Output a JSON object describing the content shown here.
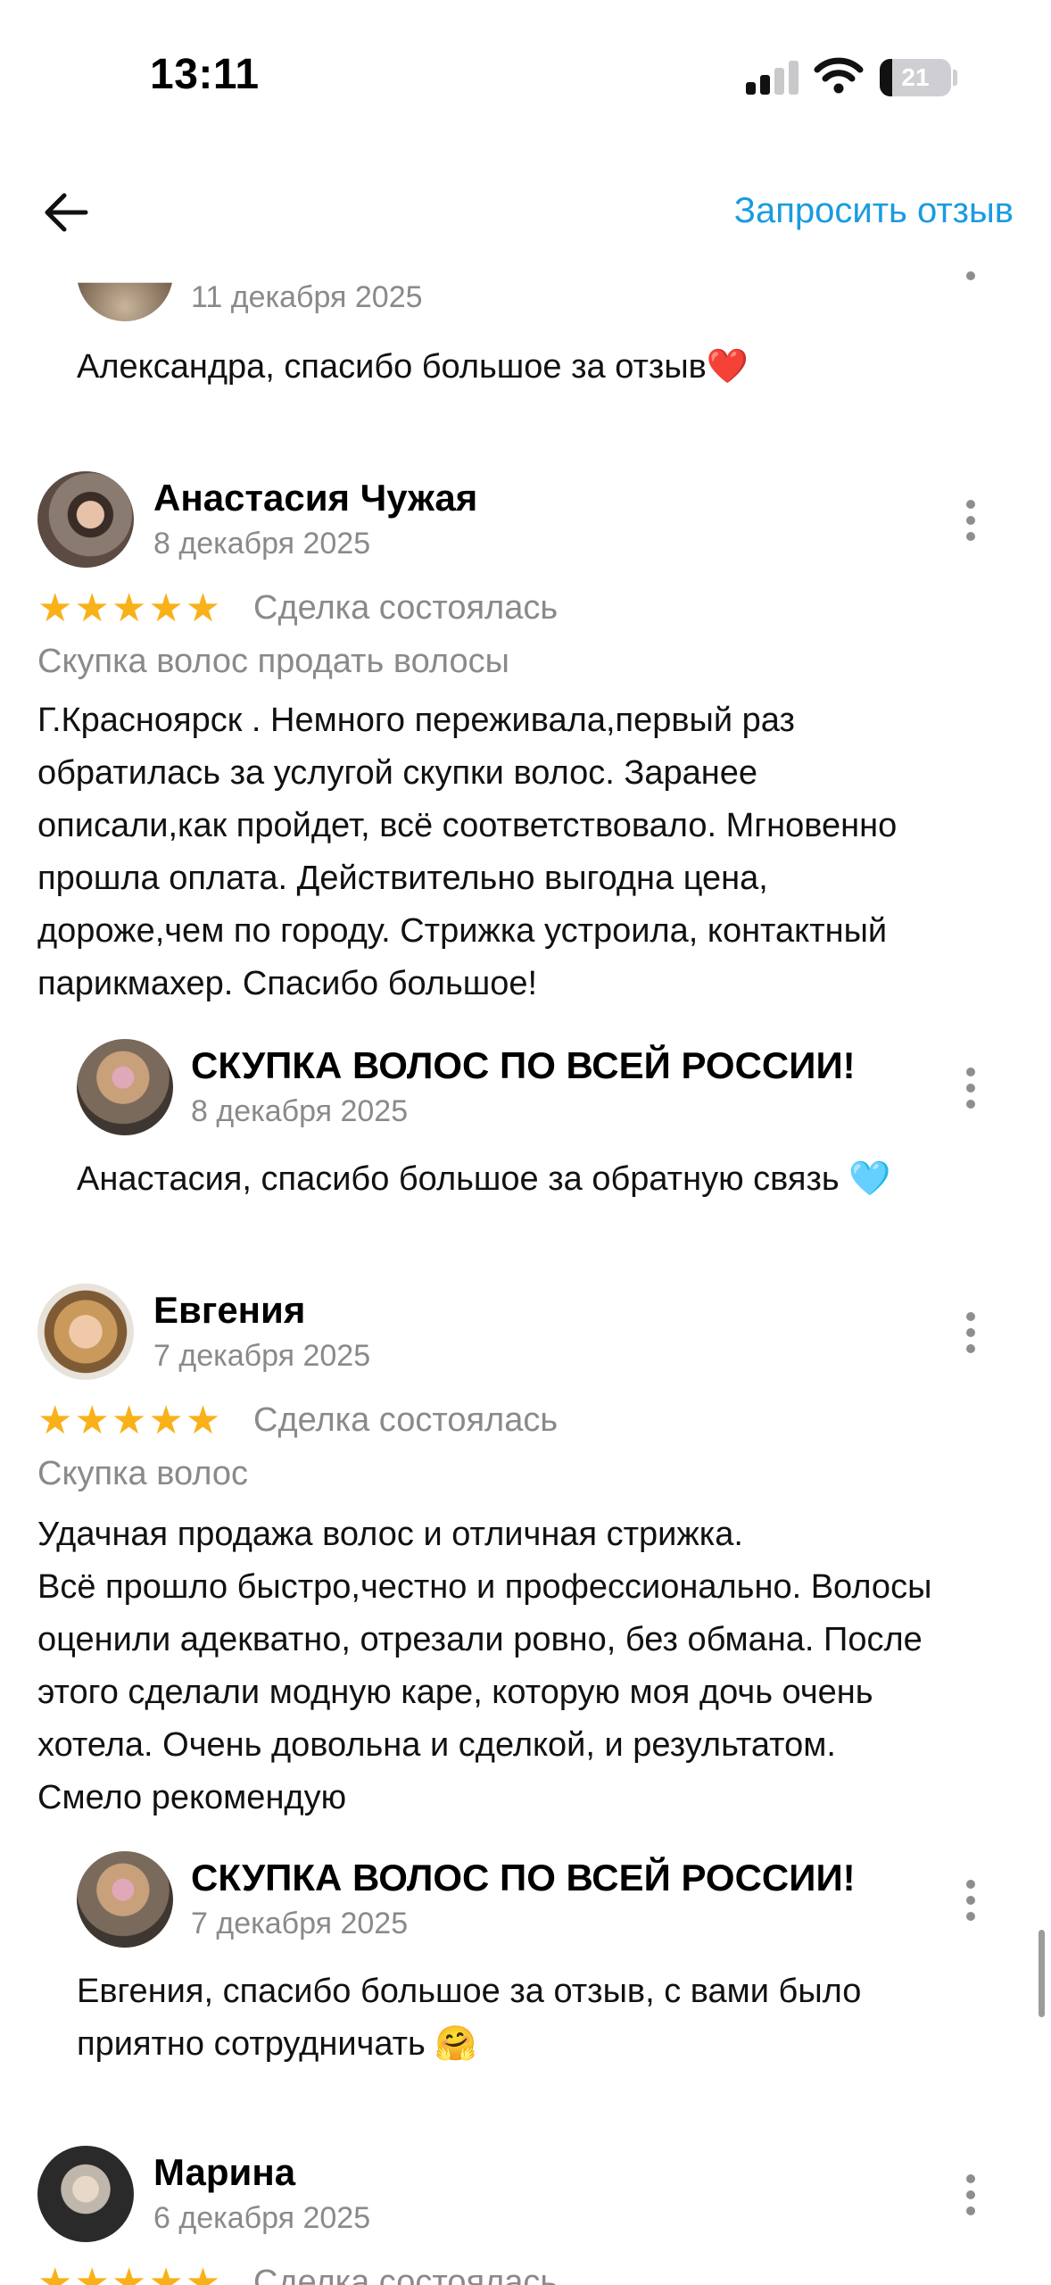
{
  "status": {
    "time": "13:11",
    "battery": "21"
  },
  "header": {
    "back_icon": "arrow-left-icon",
    "request_review": "Запросить отзыв"
  },
  "reviews": [
    {
      "reply": {
        "date": "11 декабря 2025",
        "text": "Александра, спасибо большое за отзыв❤️"
      }
    },
    {
      "author": "Анастасия Чужая",
      "date": "8 декабря 2025",
      "rating": 5,
      "stars": "★★★★★",
      "deal_status": "Сделка состоялась",
      "service": "Скупка волос продать волосы",
      "text": "Г.Красноярск . Немного переживала,первый раз\nобратилась за услугой скупки волос. Заранее\nописали,как пройдет, всё соответствовало. Мгновенно\nпрошла оплата. Действительно выгодна цена,\nдороже,чем по городу. Стрижка устроила, контактный\nпарикмахер. Спасибо большое!",
      "reply": {
        "author": "СКУПКА ВОЛОС ПО ВСЕЙ РОССИИ!",
        "date": "8 декабря 2025",
        "text": "Анастасия, спасибо большое за обратную связь 🩵"
      }
    },
    {
      "author": "Евгения",
      "date": "7 декабря 2025",
      "rating": 5,
      "stars": "★★★★★",
      "deal_status": "Сделка состоялась",
      "service": "Скупка волос",
      "text": "Удачная продажа волос и отличная стрижка.\nВсё прошло быстро,честно и профессионально. Волосы\nоценили адекватно, отрезали ровно, без обмана. После\nэтого сделали модную каре, которую моя дочь очень\nхотела. Очень довольна и сделкой, и результатом.\nСмело рекомендую",
      "reply": {
        "author": "СКУПКА ВОЛОС ПО ВСЕЙ РОССИИ!",
        "date": "7 декабря 2025",
        "text": "Евгения, спасибо большое за отзыв, с вами было\nприятно сотрудничать 🤗"
      }
    },
    {
      "author": "Марина",
      "date": "6 декабря 2025",
      "rating": 5,
      "stars": "★★★★★",
      "deal_status": "Сделка состоялась"
    }
  ],
  "colors": {
    "accent": "#1a9be0",
    "star": "#f9b11a",
    "muted": "#8a8a8a"
  }
}
